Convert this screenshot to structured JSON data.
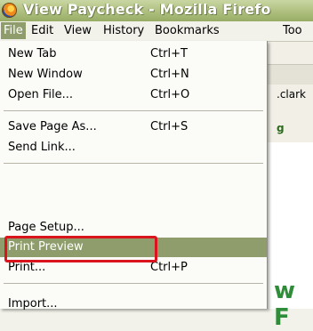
{
  "window": {
    "title": "View Paycheck - Mozilla Firefox",
    "title_visible": "View Paycheck - Mozilla Firefo"
  },
  "menubar": {
    "items": [
      {
        "label": "File"
      },
      {
        "label": "Edit"
      },
      {
        "label": "View"
      },
      {
        "label": "History"
      },
      {
        "label": "Bookmarks"
      },
      {
        "label": "Too"
      }
    ]
  },
  "file_menu": {
    "items": [
      {
        "label": "New Tab",
        "shortcut": "Ctrl+T"
      },
      {
        "label": "New Window",
        "shortcut": "Ctrl+N"
      },
      {
        "label": "Open File...",
        "shortcut": "Ctrl+O"
      },
      {
        "label": "Save Page As...",
        "shortcut": "Ctrl+S"
      },
      {
        "label": "Send Link..."
      },
      {
        "label": "Page Setup..."
      },
      {
        "label": "Print Preview",
        "highlighted": true
      },
      {
        "label": "Print...",
        "shortcut": "Ctrl+P"
      },
      {
        "label": "Import..."
      }
    ]
  },
  "background": {
    "fragment_1": ".clark",
    "fragment_2": "g",
    "heading_fragment": "w F"
  },
  "colors": {
    "highlight": "#8f9d6c",
    "callout": "#d9141c"
  }
}
